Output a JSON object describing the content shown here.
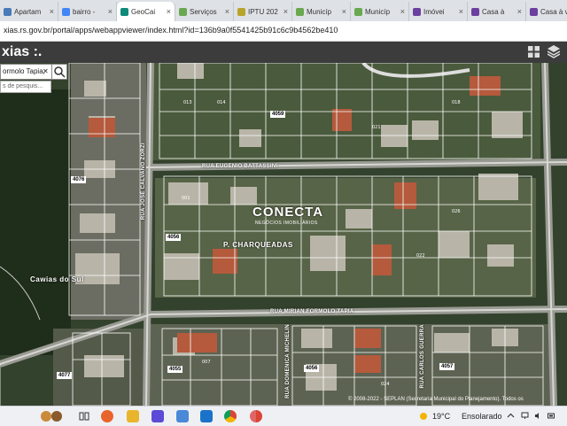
{
  "browser": {
    "tabs": [
      {
        "label": "Apartam",
        "color": "#4a7ab8",
        "active": false
      },
      {
        "label": "bairro -",
        "color": "#4285f4",
        "active": false
      },
      {
        "label": "GeoCai",
        "color": "#0f8a7a",
        "active": true
      },
      {
        "label": "Serviços",
        "color": "#6aa84f",
        "active": false
      },
      {
        "label": "IPTU 202",
        "color": "#b7a42a",
        "active": false
      },
      {
        "label": "Municíp",
        "color": "#6aa84f",
        "active": false
      },
      {
        "label": "Municíp",
        "color": "#6aa84f",
        "active": false
      },
      {
        "label": "Imóvei",
        "color": "#6b3fa0",
        "active": false
      },
      {
        "label": "Casa à",
        "color": "#6b3fa0",
        "active": false
      },
      {
        "label": "Casa à v",
        "color": "#6b3fa0",
        "active": false
      }
    ],
    "close_glyph": "×",
    "url": "xias.rs.gov.br/portal/apps/webappviewer/index.html?id=136b9a0f5541425b91c6c9b4562be410"
  },
  "app": {
    "title": "xias :.",
    "icons": {
      "grid": "grid-icon",
      "layers": "layers-icon"
    }
  },
  "search": {
    "value": "ormolo Tapia,",
    "clear": "✕",
    "suggestion": "s de pesquis..."
  },
  "map": {
    "streets": {
      "eugenio": "RUA EUGENIO BATTASSINI",
      "miriam": "RUA MIRIAN FORMOLO TAPIA",
      "jose": "RUA JOSÉ CALVANO ZORZI",
      "domenica": "RUA DOMENICA MICHELIN",
      "carlos": "RUA CARLOS GUERRA"
    },
    "districts": {
      "charqueadas": "P. CHARQUEADAS",
      "cawiasdosul": "Cawias do Sul"
    },
    "blocks": [
      "4059",
      "4076",
      "4056",
      "4055",
      "4056",
      "4057",
      "4077"
    ],
    "brand": {
      "name": "CONECTA",
      "tagline": "NEGÓCIOS IMOBILIÁRIOS"
    },
    "attribution": "© 2008-2022 - SEPLAN (Secretaria Municipal do Planejamento). Todos os"
  },
  "taskbar": {
    "temperature": "19°C",
    "condition": "Ensolarado",
    "icons": [
      "widgets-icon",
      "taskview-icon",
      "firefox-icon",
      "file-explorer-icon",
      "vs-icon",
      "mail-icon",
      "outlook-icon",
      "chrome-icon",
      "chrome-profile-icon"
    ]
  },
  "colors": {
    "accent": "#1a73e8",
    "header": "#3c3c3c",
    "lot_lines": "#ffffff"
  }
}
